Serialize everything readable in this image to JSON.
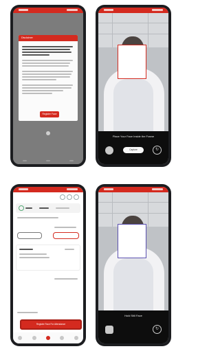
{
  "phones": [
    {
      "id": "consent",
      "dialog": {
        "title": "Disclaimer",
        "body": "Your Unsuitable for Disk",
        "button_label": "Register Face"
      }
    },
    {
      "id": "capture-1",
      "message": "Place Your Face Inside the Frame",
      "capture_label": "Capture",
      "switch_icon": "camera-switch-icon"
    },
    {
      "id": "home",
      "cta_label": "Register Face For Attendance",
      "active_nav": "home"
    },
    {
      "id": "capture-2",
      "message": "Hold Still Face",
      "switch_icon": "camera-switch-icon"
    }
  ],
  "colors": {
    "brand": "#d42a1f",
    "face_box_1": "#d42a1f",
    "face_box_2": "#5a4fb0",
    "panel": "#0d0d0d"
  }
}
